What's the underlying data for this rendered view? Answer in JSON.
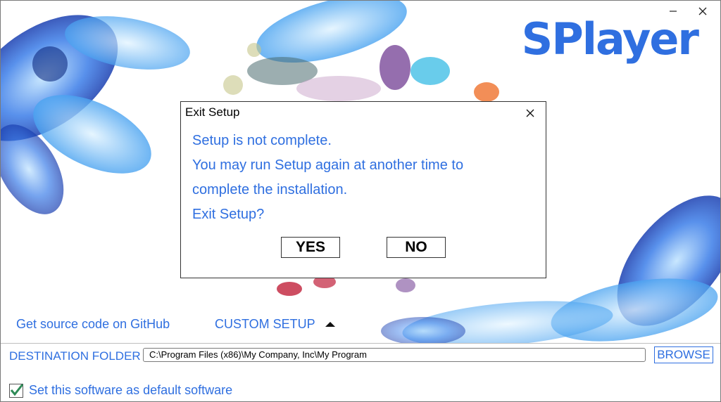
{
  "app": {
    "logo_text": "SPlayer",
    "minimize_icon": "minimize-icon",
    "close_icon": "close-icon"
  },
  "links": {
    "github": "Get source code on GitHub",
    "custom_setup": "CUSTOM SETUP"
  },
  "destination": {
    "label": "DESTINATION FOLDER",
    "path": "C:\\Program Files (x86)\\My Company, Inc\\My Program",
    "browse_label": "BROWSE"
  },
  "default_software": {
    "checked": true,
    "label": "Set this software as default software"
  },
  "dialog": {
    "title": "Exit Setup",
    "lines": [
      "Setup is not complete.",
      "You may run Setup again at another time to",
      "complete the installation.",
      "Exit Setup?"
    ],
    "yes_label": "YES",
    "no_label": "NO"
  },
  "colors": {
    "accent": "#2f6fe0",
    "text": "#000000"
  }
}
